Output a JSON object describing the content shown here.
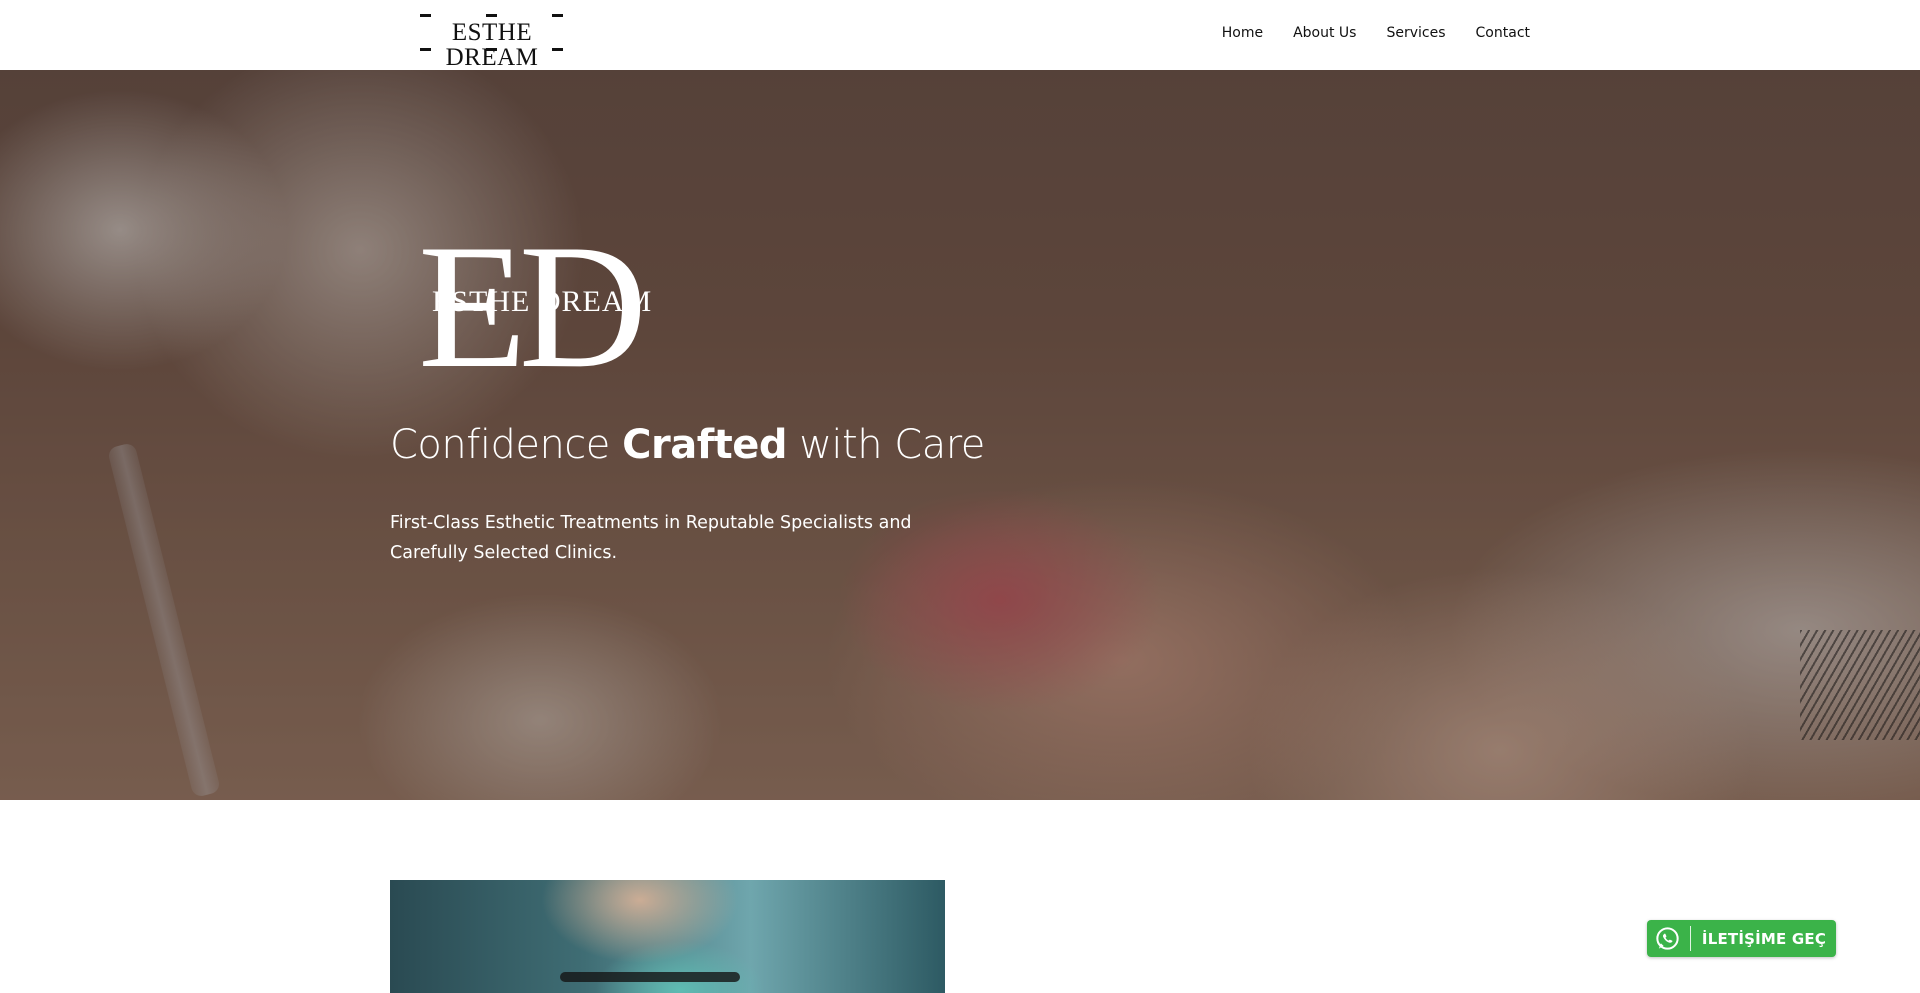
{
  "header": {
    "logo_text": "ESTHE DREAM",
    "nav": [
      {
        "label": "Home"
      },
      {
        "label": "About Us"
      },
      {
        "label": "Services"
      },
      {
        "label": "Contact"
      }
    ]
  },
  "hero": {
    "logo_monogram": "ED",
    "logo_text": "ESTHE DREAM",
    "title_part1": "Confidence ",
    "title_bold": "Crafted",
    "title_part2": " with Care",
    "subtitle": "First-Class Esthetic Treatments in Reputable Specialists and Carefully Selected Clinics."
  },
  "whatsapp_button": {
    "label": "İLETİŞİME GEÇ",
    "icon": "whatsapp-icon",
    "color": "#3bb349"
  }
}
